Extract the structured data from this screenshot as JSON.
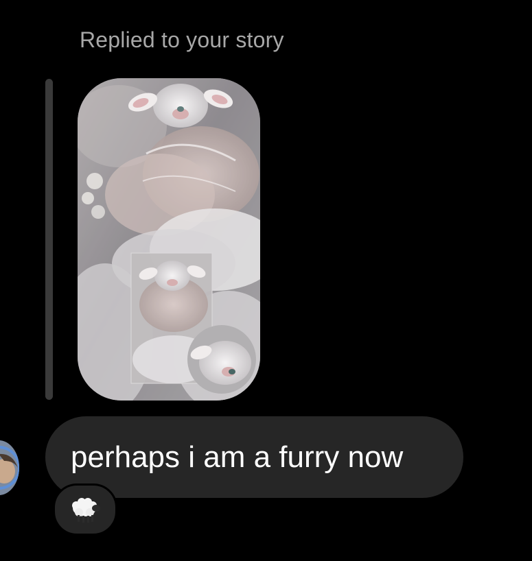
{
  "story_reply": {
    "caption": "Replied to your story",
    "thumbnail": {
      "icon": "story-image",
      "description_visible": false
    }
  },
  "message": {
    "text": "perhaps i am a furry now",
    "reaction": {
      "icon": "sheep-emoji"
    }
  },
  "avatar": {
    "icon": "user-avatar"
  },
  "colors": {
    "background": "#000000",
    "bubble": "#262626",
    "caption": "#a8a8a8",
    "reply_bar": "#3a3a3a",
    "text": "#ffffff"
  }
}
